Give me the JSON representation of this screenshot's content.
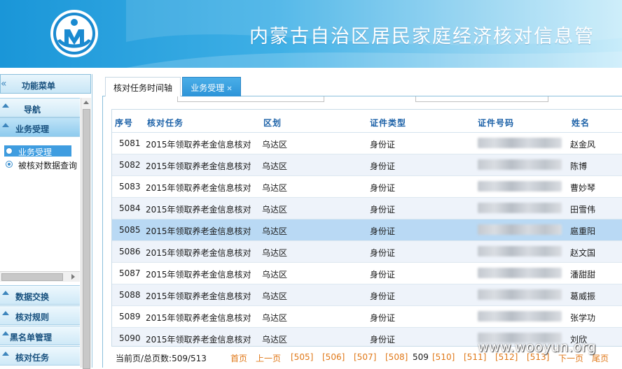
{
  "header": {
    "title": "内蒙古自治区居民家庭经济核对信息管"
  },
  "sidebar": {
    "menu_title": "功能菜单",
    "groups_top": [
      {
        "label": "导航"
      },
      {
        "label": "业务受理"
      }
    ],
    "items": [
      {
        "label": "业务受理"
      },
      {
        "label": "被核对数据查询"
      }
    ],
    "groups_bottom": [
      {
        "label": "数据交换"
      },
      {
        "label": "核对规则"
      },
      {
        "label": "黑名单管理"
      },
      {
        "label": "核对任务"
      }
    ]
  },
  "tabs": [
    {
      "label": "核对任务时间轴"
    },
    {
      "label": "业务受理"
    }
  ],
  "table": {
    "headers": [
      "序号",
      "核对任务",
      "区划",
      "证件类型",
      "证件号码",
      "姓名"
    ],
    "rows": [
      {
        "no": "5081",
        "task": "2015年领取养老金信息核对",
        "region": "乌达区",
        "idtype": "身份证",
        "name": "赵金风"
      },
      {
        "no": "5082",
        "task": "2015年领取养老金信息核对",
        "region": "乌达区",
        "idtype": "身份证",
        "name": "陈博"
      },
      {
        "no": "5083",
        "task": "2015年领取养老金信息核对",
        "region": "乌达区",
        "idtype": "身份证",
        "name": "曹妙琴"
      },
      {
        "no": "5084",
        "task": "2015年领取养老金信息核对",
        "region": "乌达区",
        "idtype": "身份证",
        "name": "田雪伟"
      },
      {
        "no": "5085",
        "task": "2015年领取养老金信息核对",
        "region": "乌达区",
        "idtype": "身份证",
        "name": "扈重阳"
      },
      {
        "no": "5086",
        "task": "2015年领取养老金信息核对",
        "region": "乌达区",
        "idtype": "身份证",
        "name": "赵文国"
      },
      {
        "no": "5087",
        "task": "2015年领取养老金信息核对",
        "region": "乌达区",
        "idtype": "身份证",
        "name": "潘甜甜"
      },
      {
        "no": "5088",
        "task": "2015年领取养老金信息核对",
        "region": "乌达区",
        "idtype": "身份证",
        "name": "葛威振"
      },
      {
        "no": "5089",
        "task": "2015年领取养老金信息核对",
        "region": "乌达区",
        "idtype": "身份证",
        "name": "张学功"
      },
      {
        "no": "5090",
        "task": "2015年领取养老金信息核对",
        "region": "乌达区",
        "idtype": "身份证",
        "name": "刘欣"
      }
    ]
  },
  "pager": {
    "summary": "当前页/总页数:509/513",
    "first": "首页",
    "prev": "上一页",
    "pages": [
      "[505]",
      "[506]",
      "[507]",
      "[508]"
    ],
    "current": "509",
    "pages_after": [
      "[510]",
      "[511]",
      "[512]",
      "[513]"
    ],
    "next": "下一页",
    "last": "尾页"
  },
  "watermark": "www.wooyun.org",
  "colors": {
    "header_blue": "#1a96d8",
    "link_orange": "#e07818",
    "header_text": "#1d62a8",
    "row_highlight": "#b9d9f4"
  }
}
